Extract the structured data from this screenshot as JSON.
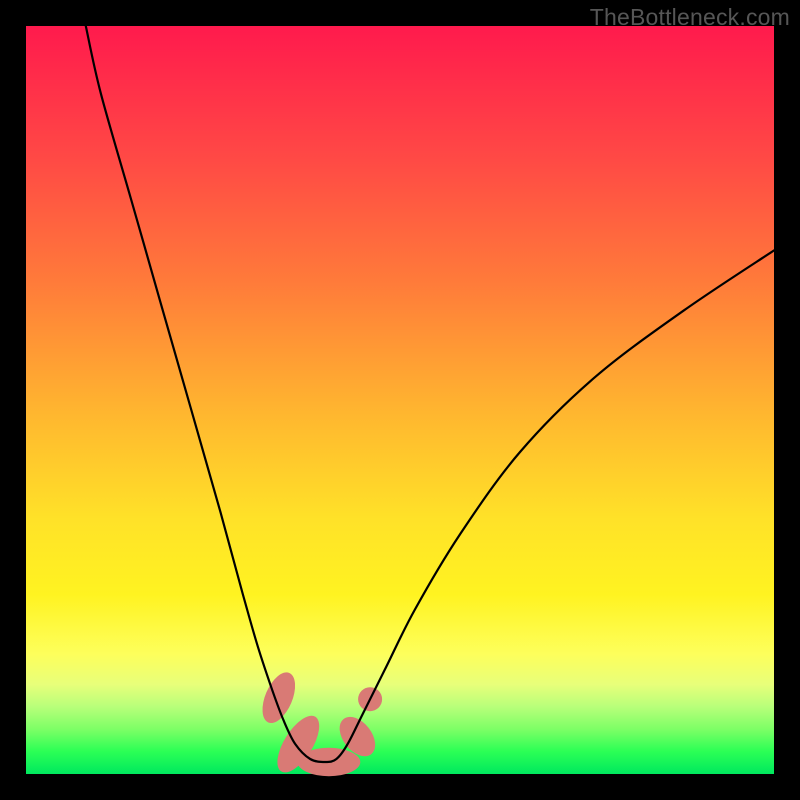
{
  "watermark": "TheBottleneck.com",
  "chart_data": {
    "type": "line",
    "title": "",
    "xlabel": "",
    "ylabel": "",
    "xlim": [
      0,
      100
    ],
    "ylim": [
      0,
      100
    ],
    "series": [
      {
        "name": "curve",
        "x": [
          8,
          10,
          14,
          18,
          22,
          26,
          29,
          31,
          33,
          34.5,
          36,
          38,
          40,
          41.5,
          43,
          45,
          48,
          52,
          58,
          66,
          76,
          88,
          100
        ],
        "y": [
          100,
          91,
          77,
          63,
          49,
          35,
          24,
          17,
          11,
          7,
          4,
          2,
          1.6,
          2,
          4,
          8,
          14,
          22,
          32,
          43,
          53,
          62,
          70
        ]
      }
    ],
    "markers": [
      {
        "name": "marker-left-upper",
        "x": 33.8,
        "y": 10.2,
        "rx": 1.8,
        "ry": 3.6,
        "rot": 23,
        "color": "#d97a75"
      },
      {
        "name": "marker-left-lower",
        "x": 36.4,
        "y": 4.0,
        "rx": 1.9,
        "ry": 4.3,
        "rot": 32,
        "color": "#d97a75"
      },
      {
        "name": "marker-bottom",
        "x": 40.5,
        "y": 1.6,
        "rx": 4.2,
        "ry": 1.9,
        "rot": 0,
        "color": "#d97a75"
      },
      {
        "name": "marker-right-lower",
        "x": 44.3,
        "y": 5.0,
        "rx": 1.9,
        "ry": 3.0,
        "rot": -38,
        "color": "#d97a75"
      },
      {
        "name": "marker-right-upper",
        "x": 46.0,
        "y": 10.0,
        "rx": 1.6,
        "ry": 1.6,
        "rot": 0,
        "color": "#d97a75"
      }
    ]
  }
}
